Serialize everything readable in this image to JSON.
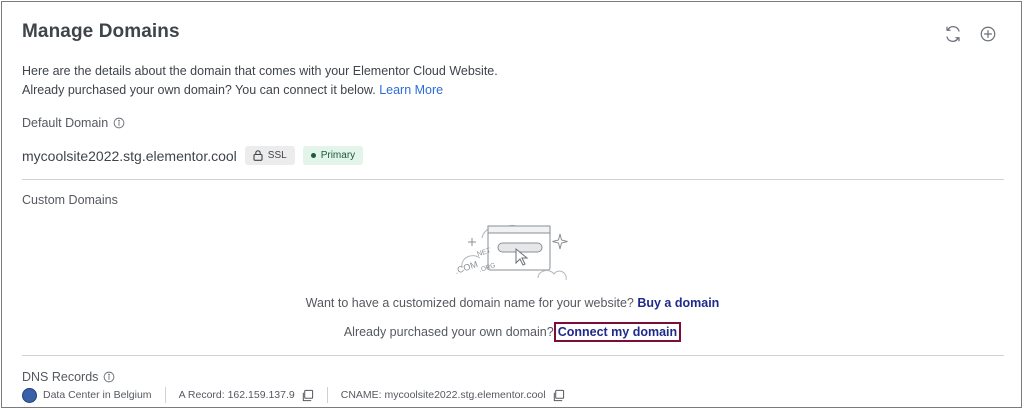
{
  "header": {
    "title": "Manage Domains",
    "refresh_icon": "refresh-icon",
    "add_icon": "add-circle-icon"
  },
  "intro": {
    "line1": "Here are the details about the domain that comes with your Elementor Cloud Website.",
    "line2": "Already purchased your own domain? You can connect it below.",
    "learn_more": "Learn More"
  },
  "default_domain": {
    "label": "Default Domain",
    "domain": "mycoolsite2022.stg.elementor.cool",
    "ssl_label": "SSL",
    "primary_label": "Primary"
  },
  "custom_domains": {
    "label": "Custom Domains",
    "illustration_text": [
      ".NET",
      ".COM",
      ".ORG"
    ],
    "buy_prompt": "Want to have a customized domain name for your website?",
    "buy_link": "Buy a domain",
    "connect_prompt": "Already purchased your own domain?",
    "connect_link": "Connect my domain"
  },
  "dns": {
    "label": "DNS Records",
    "data_center": "Data Center in Belgium",
    "a_record": "A Record: 162.159.137.9",
    "cname": "CNAME: mycoolsite2022.stg.elementor.cool"
  },
  "colors": {
    "link": "#2d6cdb",
    "strong_link": "#1e2a8a",
    "primary_badge_bg": "#e3f4ea",
    "highlight_border": "#7a0d3a"
  }
}
